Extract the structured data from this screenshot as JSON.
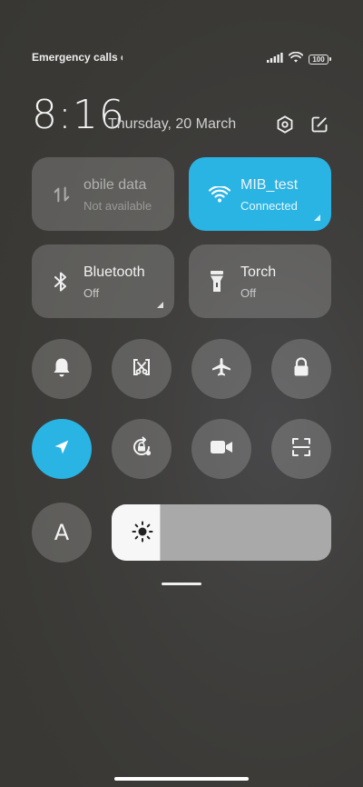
{
  "status_bar": {
    "carrier_text": "Emergency calls o",
    "battery_level": "100"
  },
  "header": {
    "time": "8:16",
    "date": "Thursday, 20 March"
  },
  "tiles": {
    "mobile_data": {
      "label": "obile data",
      "sub": "Not available"
    },
    "wifi": {
      "label": "MIB_test",
      "sub": "Connected"
    },
    "bluetooth": {
      "label": "Bluetooth",
      "sub": "Off"
    },
    "torch": {
      "label": "Torch",
      "sub": "Off"
    }
  },
  "font_toggle_label": "A",
  "brightness_level": 0.22,
  "colors": {
    "accent": "#29b4e4",
    "tile_bg": "rgba(255,255,255,0.18)",
    "background": "#3b3a37"
  }
}
